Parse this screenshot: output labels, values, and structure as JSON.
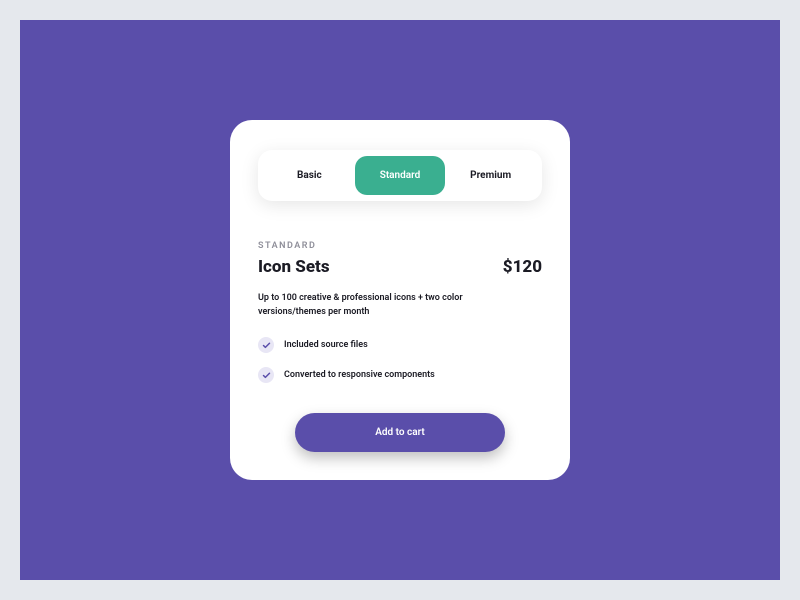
{
  "tabs": {
    "basic": "Basic",
    "standard": "Standard",
    "premium": "Premium"
  },
  "plan": {
    "label": "STANDARD",
    "title": "Icon Sets",
    "price": "$120",
    "description": "Up to 100 creative & professional  icons + two color versions/themes per month"
  },
  "features": {
    "item0": "Included  source files",
    "item1": "Converted to responsive components"
  },
  "cta": {
    "add_to_cart": "Add to cart"
  },
  "colors": {
    "background": "#5a4eaa",
    "accent": "#3aaf90",
    "page": "#e5e8ed"
  }
}
